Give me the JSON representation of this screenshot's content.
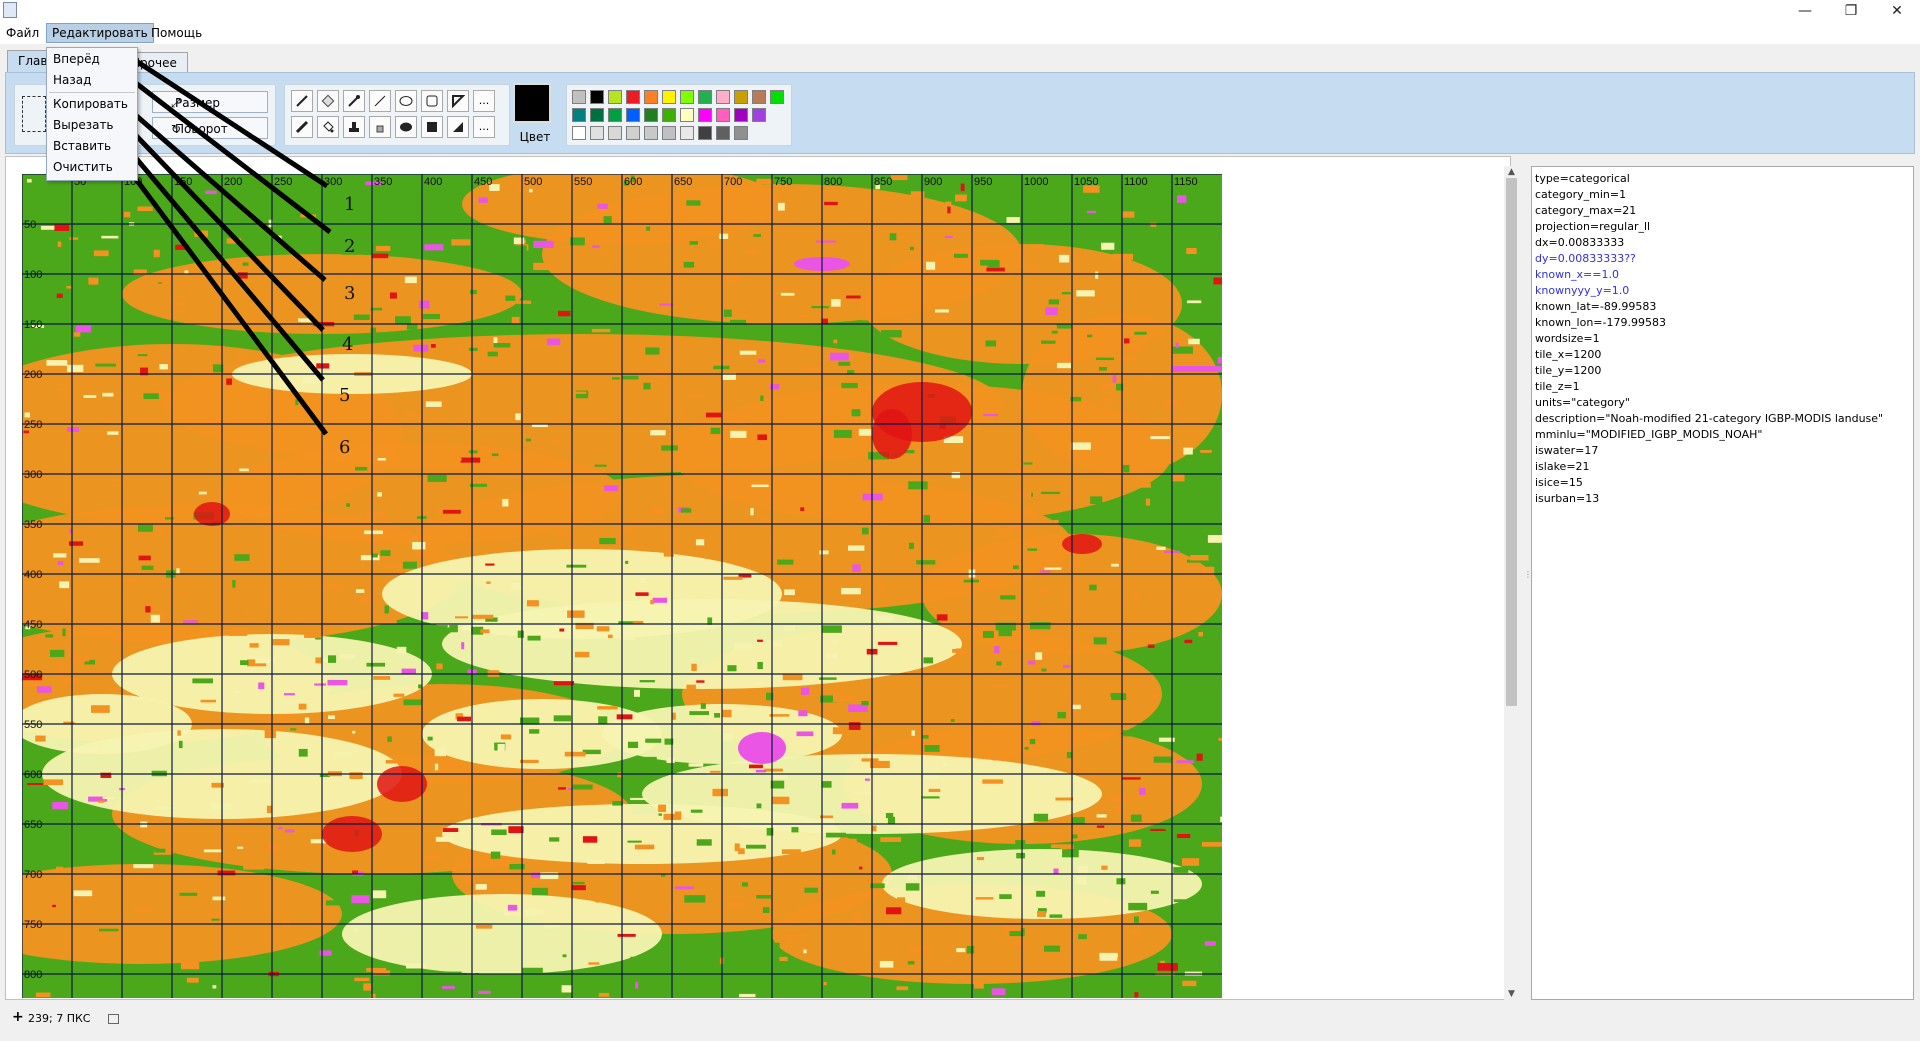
{
  "menu": {
    "file": "Файл",
    "edit": "Редактировать",
    "help": "Помощь"
  },
  "tabs": {
    "main": "Глав",
    "other": "Прочее"
  },
  "edit_menu": {
    "items": [
      "Вперёд",
      "Назад",
      "Копировать",
      "Вырезать",
      "Вставить",
      "Очистить"
    ]
  },
  "ribbon": {
    "resize_label": "Размер",
    "rotate_label": "Поворот",
    "more_label": "...",
    "color_label": "Цвет",
    "palette": [
      "#c0c0c0",
      "#000000",
      "#b5e61d",
      "#ed1c24",
      "#ff7f27",
      "#fff200",
      "#7fff00",
      "#22b14c",
      "#ffaec9",
      "#c8a000",
      "#b97a57",
      "#00e000",
      "#008080",
      "#007040",
      "#00a040",
      "#0060ff",
      "#208020",
      "#40b000",
      "#ffffc0",
      "#ff00ff",
      "#ff60c0",
      "#a000c0",
      "#a040e0",
      "#ffffff",
      "#e0e0e0",
      "#d8d8d8",
      "#d0d0d0",
      "#c8c8c8",
      "#c0c0c0",
      "#e8e8e8",
      "#404040",
      "#606060",
      "#909090"
    ]
  },
  "map": {
    "x_ticks": [
      "50",
      "100",
      "150",
      "200",
      "250",
      "300",
      "350",
      "400",
      "450",
      "500",
      "550",
      "600",
      "650",
      "700",
      "750",
      "800",
      "850",
      "900",
      "950",
      "1000",
      "1050",
      "1100",
      "1150"
    ],
    "y_ticks": [
      "50",
      "100",
      "150",
      "200",
      "250",
      "300",
      "350",
      "400",
      "450",
      "500",
      "550",
      "600",
      "650",
      "700",
      "750",
      "800"
    ],
    "colors": {
      "green": "#4aa81a",
      "orange": "#f39220",
      "cream": "#f6f3b0",
      "magenta": "#ea55e6",
      "red": "#e01414"
    }
  },
  "annotations": [
    "1",
    "2",
    "3",
    "4",
    "5",
    "6"
  ],
  "metadata_text": [
    "type=categorical",
    "category_min=1",
    "category_max=21",
    "projection=regular_ll",
    "dx=0.00833333",
    "dy=0.00833333??",
    "known_x==1.0",
    "knownyyy_y=1.0",
    "known_lat=-89.99583",
    "known_lon=-179.99583",
    "wordsize=1",
    "tile_x=1200",
    "tile_y=1200",
    "tile_z=1",
    "units=\"category\"",
    "description=\"Noah-modified 21-category IGBP-MODIS landuse\"",
    "mminlu=\"MODIFIED_IGBP_MODIS_NOAH\"",
    "iswater=17",
    "islake=21",
    "isice=15",
    "isurban=13"
  ],
  "status": {
    "coords": "239; 7 ПКС"
  }
}
